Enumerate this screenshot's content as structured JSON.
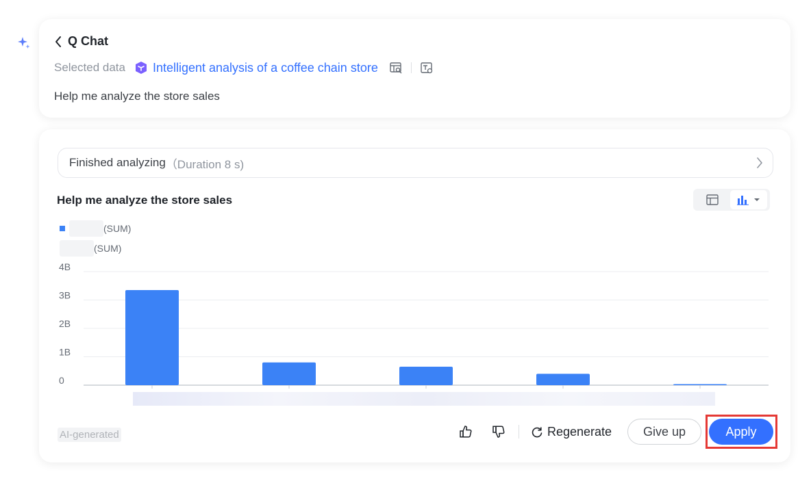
{
  "header": {
    "back_title": "Q Chat",
    "selected_label": "Selected data",
    "dataset_name": "Intelligent analysis of a coffee chain store",
    "prompt": "Help me analyze the store sales"
  },
  "result": {
    "status": "Finished analyzing",
    "duration": "（Duration 8 s)",
    "chart_title": "Help me analyze the store sales",
    "legend_1": "(SUM)",
    "legend_2": "(SUM)",
    "ai_tag": "AI-generated"
  },
  "actions": {
    "regenerate": "Regenerate",
    "give_up": "Give up",
    "apply": "Apply"
  },
  "colors": {
    "accent": "#3370ff",
    "bar": "#3b82f6",
    "highlight": "#e53935"
  },
  "icons": [
    "sparkle-icon",
    "chevron-left-icon",
    "dataset-icon",
    "table-search-icon",
    "text-setting-icon",
    "chevron-right-icon",
    "table-view-icon",
    "bar-chart-icon",
    "caret-down-icon",
    "thumbs-up-icon",
    "thumbs-down-icon",
    "refresh-icon"
  ],
  "chart_data": {
    "type": "bar",
    "categories": [
      "",
      "",
      "",
      "",
      ""
    ],
    "values": [
      3.35,
      0.8,
      0.65,
      0.4,
      0.03
    ],
    "y_ticks": [
      "0",
      "1B",
      "2B",
      "3B",
      "4B"
    ],
    "ylim": [
      0,
      4
    ],
    "unit": "B",
    "grid": true
  }
}
